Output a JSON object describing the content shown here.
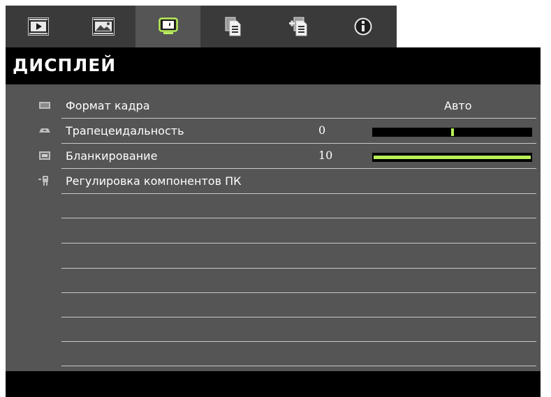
{
  "tabs": [
    {
      "icon": "play-icon",
      "label": ""
    },
    {
      "icon": "image-icon",
      "label": ""
    },
    {
      "icon": "display-icon",
      "label": ""
    },
    {
      "icon": "document-icon",
      "label": ""
    },
    {
      "icon": "document-add-icon",
      "label": ""
    },
    {
      "icon": "info-icon",
      "label": ""
    }
  ],
  "active_tab": 2,
  "header": {
    "title": "ДИСПЛЕЙ"
  },
  "menu": {
    "rows": [
      {
        "icon": "aspect-ratio-icon",
        "label": "Формат кадра",
        "value": "Авто"
      },
      {
        "icon": "keystone-icon",
        "label": "Трапецеидальность",
        "number": "0",
        "slider_min": -40,
        "slider_max": 40,
        "slider_value": 0
      },
      {
        "icon": "blanking-icon",
        "label": "Бланкирование",
        "number": "10",
        "slider_min": 0,
        "slider_max": 10,
        "slider_value": 10
      },
      {
        "icon": "pc-adjust-icon",
        "label": "Регулировка компонентов ПК"
      }
    ]
  },
  "colors": {
    "accent": "#b9f05a",
    "panel": "#555555",
    "tabbar": "#3a3a3a",
    "header": "#000000"
  }
}
